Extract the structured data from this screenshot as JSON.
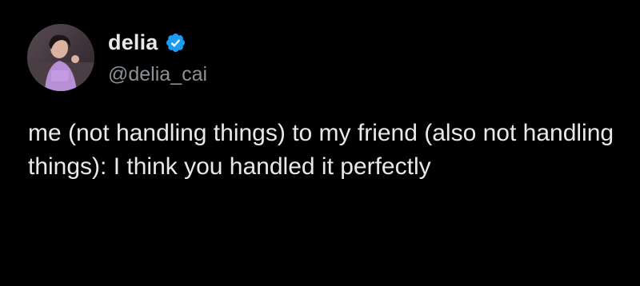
{
  "author": {
    "display_name": "delia",
    "handle": "@delia_cai",
    "verified": true,
    "verified_icon": "verified-badge-icon",
    "verified_color": "#1d9bf0",
    "avatar_icon": "profile-photo"
  },
  "tweet": {
    "text": "me (not handling things) to my friend (also not handling things): I think you handled it perfectly"
  },
  "colors": {
    "background": "#000000",
    "primary_text": "#e7e9ea",
    "secondary_text": "#8b9196"
  }
}
